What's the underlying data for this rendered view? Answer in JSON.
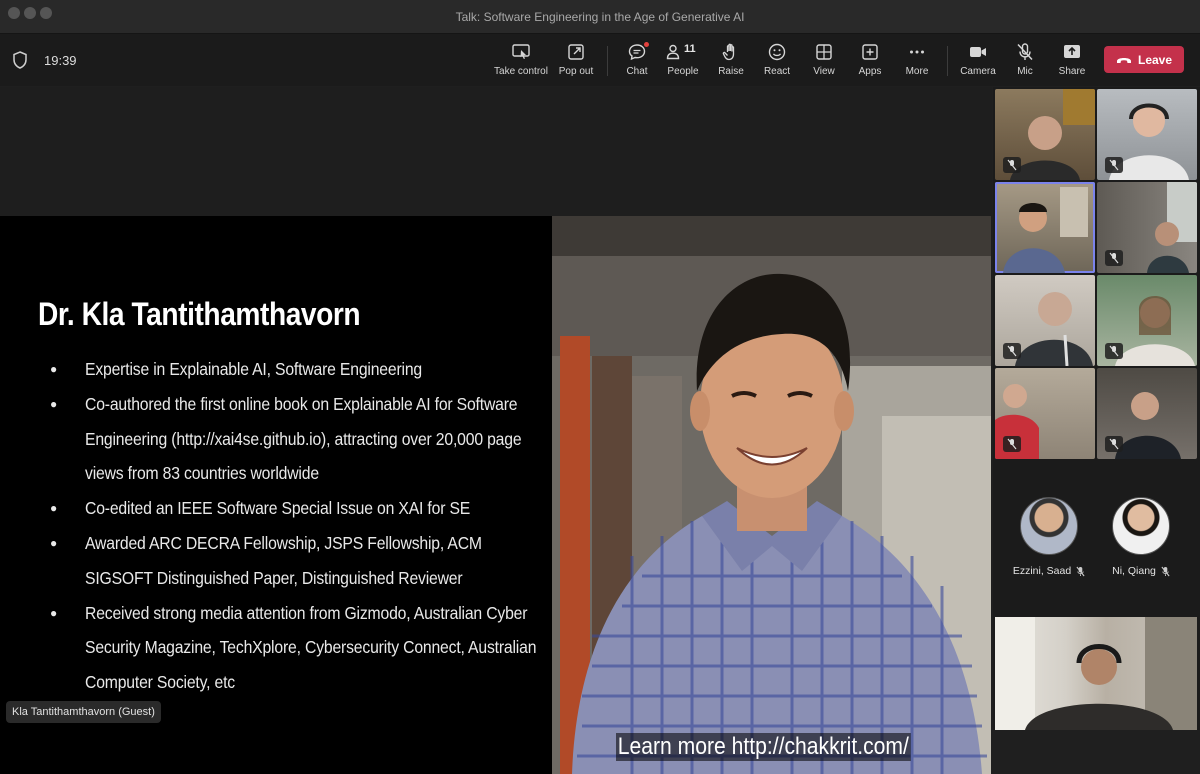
{
  "window": {
    "title": "Talk: Software Engineering in the Age of Generative AI"
  },
  "toolbar": {
    "time": "19:39",
    "take_control": "Take control",
    "pop_out": "Pop out",
    "chat": "Chat",
    "people": "People",
    "people_count": "11",
    "raise": "Raise",
    "react": "React",
    "view": "View",
    "apps": "Apps",
    "more": "More",
    "camera": "Camera",
    "mic": "Mic",
    "share": "Share",
    "leave": "Leave"
  },
  "slide": {
    "title": "Dr. Kla Tantithamthavorn",
    "bullets": [
      "Expertise in Explainable AI, Software Engineering",
      "Co-authored the first online book on Explainable AI for Software Engineering (http://xai4se.github.io), attracting over 20,000 page views from 83 countries worldwide",
      "Co-edited an IEEE Software Special Issue on XAI for SE",
      "Awarded ARC DECRA Fellowship, JSPS Fellowship, ACM SIGSOFT Distinguished Paper, Distinguished Reviewer",
      "Received strong media attention from Gizmodo, Australian Cyber Security Magazine, TechXplore, Cybersecurity Connect, Australian Computer Society, etc"
    ],
    "caption": "Learn more http://chakkrit.com/"
  },
  "presenter": {
    "name": "Kla Tantithamthavorn (Guest)"
  },
  "gallery": {
    "avatars": [
      {
        "name": "Ezzini, Saad"
      },
      {
        "name": "Ni, Qiang"
      }
    ]
  },
  "colors": {
    "leave": "#c4314b",
    "active_tile": "#7b83eb",
    "chat_badge": "#e3423e"
  }
}
